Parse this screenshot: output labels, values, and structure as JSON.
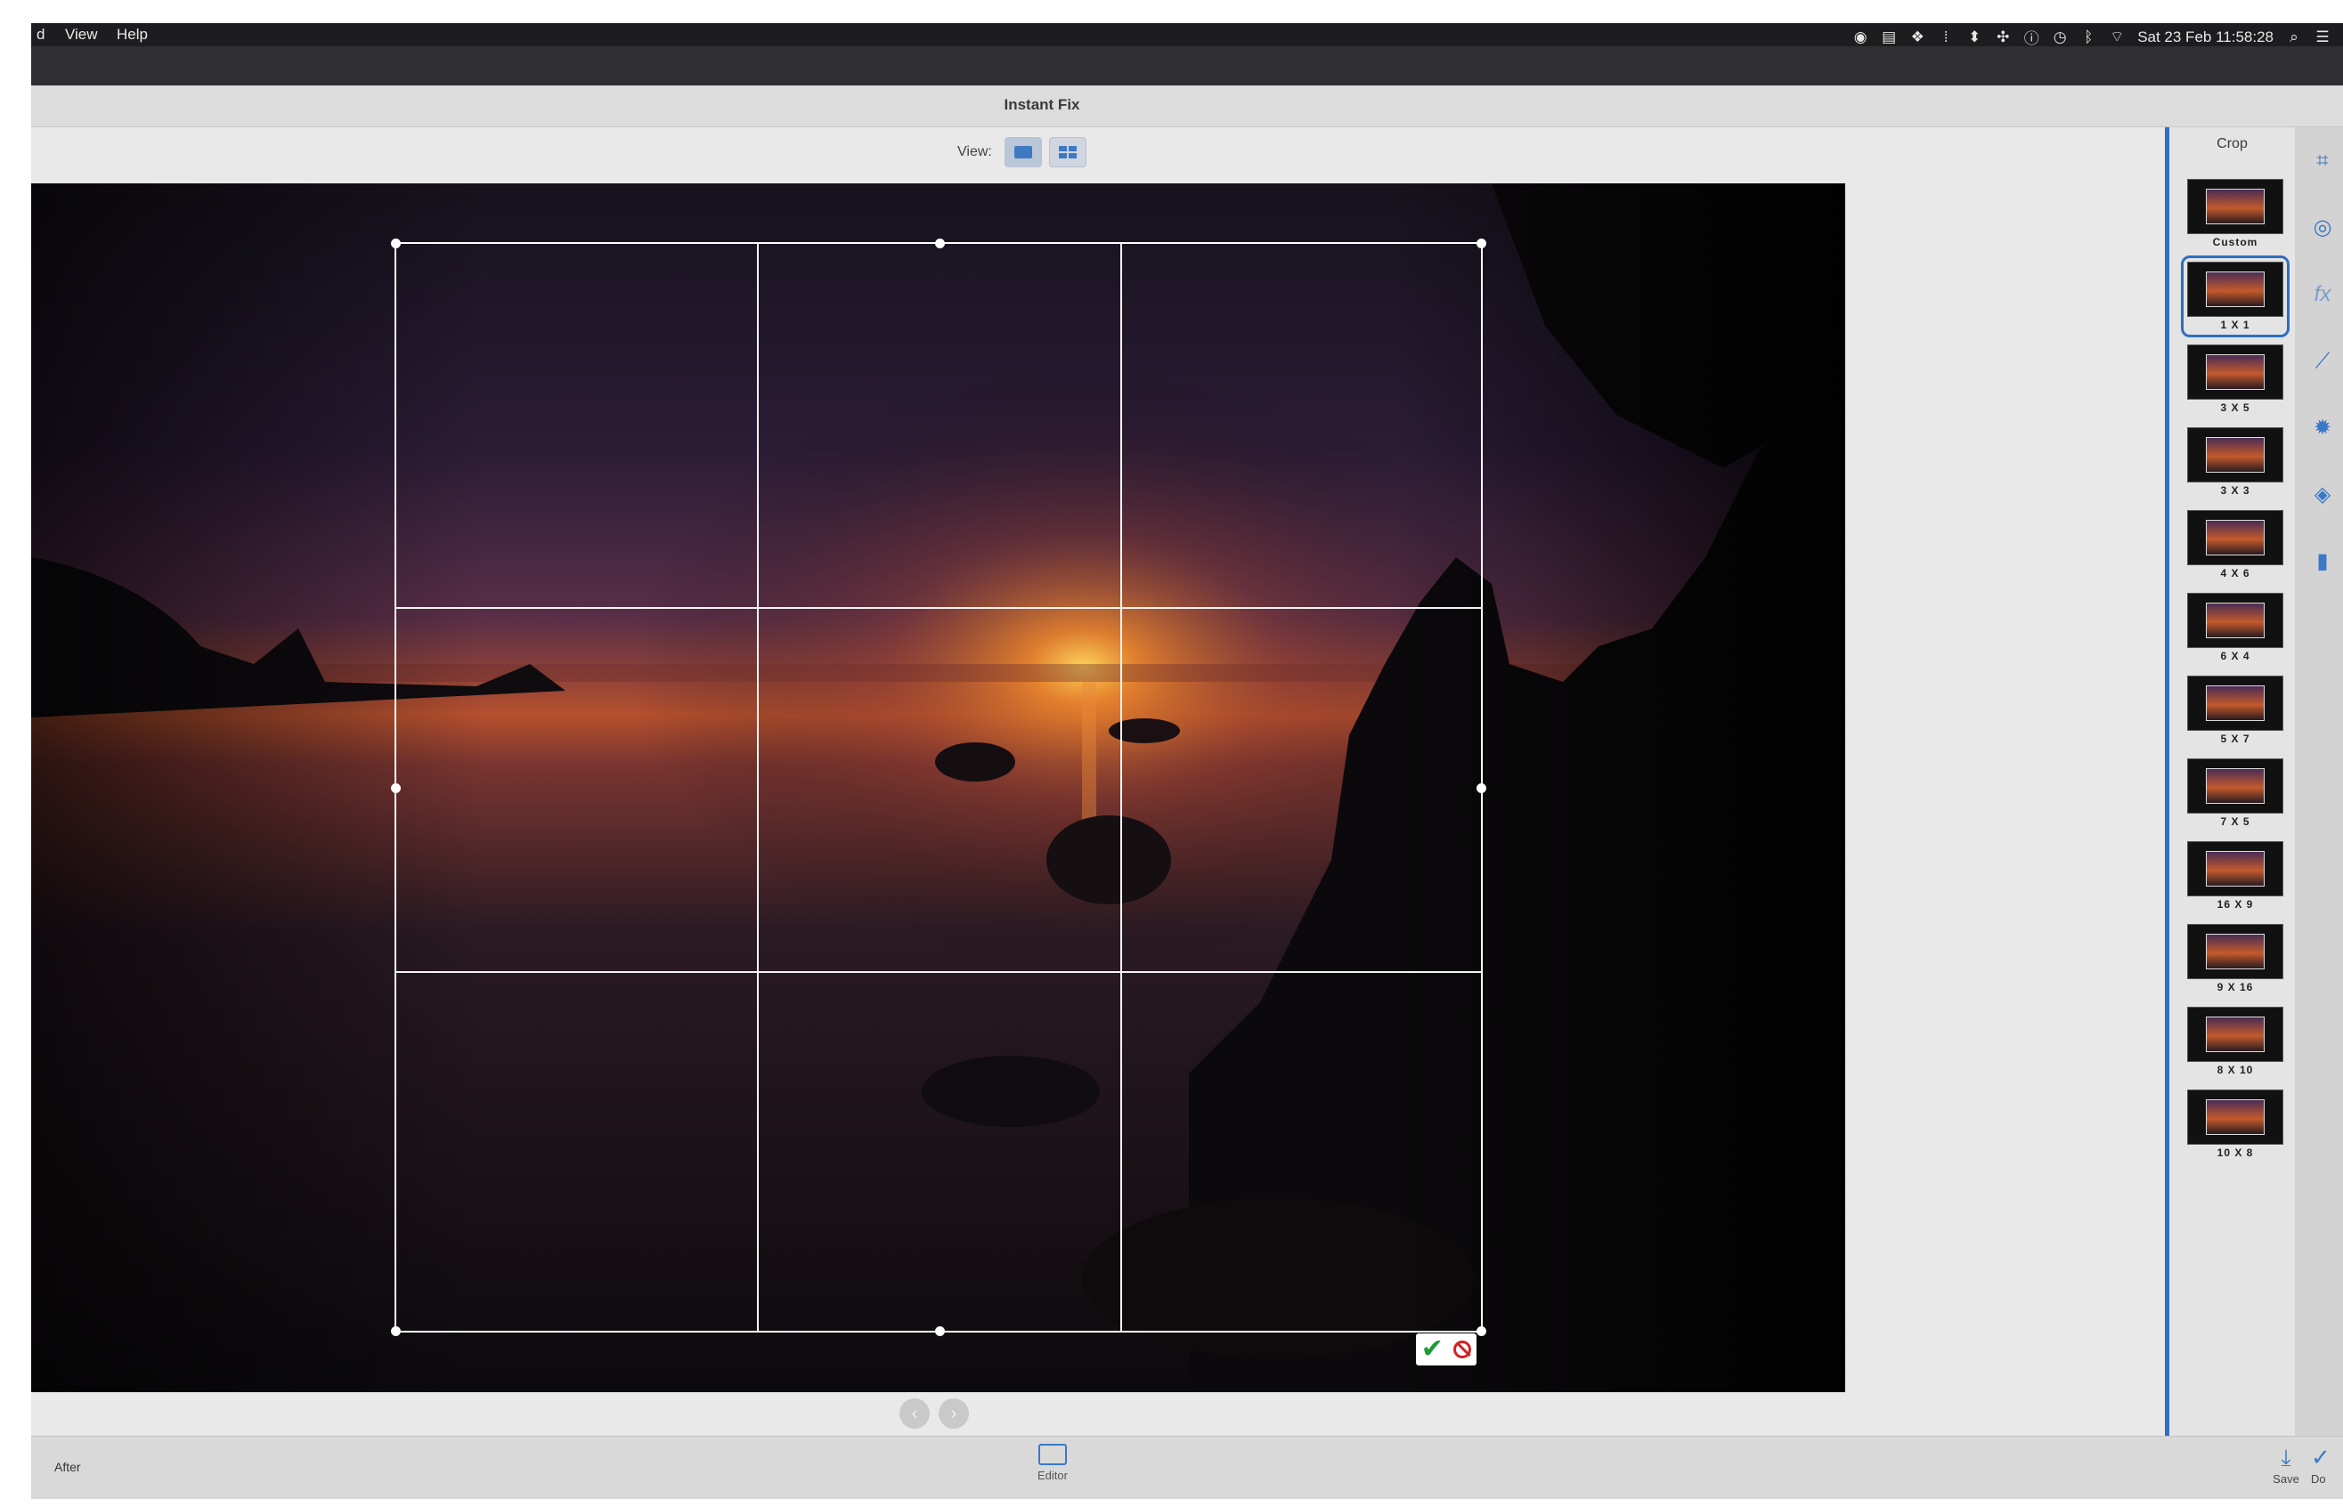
{
  "menubar": {
    "items": [
      "d",
      "View",
      "Help"
    ],
    "status_icons": [
      "camera-icon",
      "document-icon",
      "dropbox-icon",
      "bars-icon",
      "network-icon",
      "sync-icon",
      "info-icon",
      "clock-icon",
      "bluetooth-icon",
      "wifi-icon"
    ],
    "clock": "Sat 23 Feb  11:58:28"
  },
  "window": {
    "title": "Instant Fix"
  },
  "view": {
    "label": "View:"
  },
  "crop_panel": {
    "title": "Crop",
    "presets": [
      "Custom",
      "1 X 1",
      "3 X 5",
      "3 X 3",
      "4 X 6",
      "6 X 4",
      "5 X 7",
      "7 X 5",
      "16 X 9",
      "9 X 16",
      "8 X 10",
      "10 X 8"
    ],
    "selected": "1 X 1"
  },
  "bottom": {
    "after_label": "After",
    "editor_label": "Editor",
    "save_label": "Save",
    "done_label": "Do"
  },
  "colors": {
    "accent": "#2e6fc0",
    "confirm": "#1d9b34",
    "cancel": "#d22222"
  }
}
